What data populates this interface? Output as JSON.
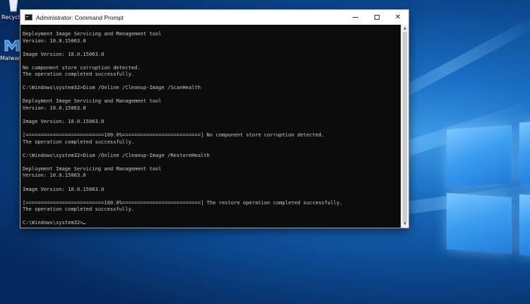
{
  "window": {
    "title": "Administrator: Command Prompt",
    "close_glyph": "✕",
    "scroll_up_glyph": "▲",
    "scroll_down_glyph": "▼"
  },
  "desktop": {
    "icons": [
      {
        "label": "Recycle Bin",
        "icon": "recycle-bin-icon"
      },
      {
        "label": "Malwarebytes",
        "icon": "malwarebytes-icon"
      }
    ]
  },
  "console": {
    "lines": [
      "Deployment Image Servicing and Management tool",
      "Version: 10.0.15063.0",
      "",
      "Image Version: 10.0.15063.0",
      "",
      "No component store corruption detected.",
      "The operation completed successfully.",
      "",
      "C:\\Windows\\system32>Dism /Online /Cleanup-Image /ScanHealth",
      "",
      "Deployment Image Servicing and Management tool",
      "Version: 10.0.15063.0",
      "",
      "Image Version: 10.0.15063.0",
      "",
      "[==========================100.0%==========================] No component store corruption detected.",
      "The operation completed successfully.",
      "",
      "C:\\Windows\\system32>Dism /Online /Cleanup-Image /RestoreHealth",
      "",
      "Deployment Image Servicing and Management tool",
      "Version: 10.0.15063.0",
      "",
      "Image Version: 10.0.15063.0",
      "",
      "[==========================100.0%==========================] The restore operation completed successfully.",
      "The operation completed successfully.",
      "",
      "C:\\Windows\\system32>"
    ]
  },
  "colors": {
    "console_bg": "#0c0c0c",
    "console_text": "#c8c8c8",
    "wallpaper_accent": "#3c9be8"
  }
}
